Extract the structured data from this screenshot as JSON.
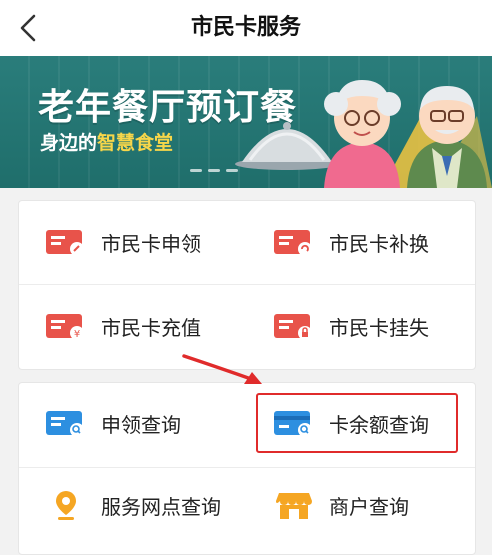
{
  "navbar": {
    "title": "市民卡服务",
    "back_icon": "chevron-left-icon"
  },
  "banner": {
    "title": "老年餐厅预订餐",
    "subtitle_prefix": "身边的",
    "subtitle_highlight": "智慧食堂",
    "colors": {
      "background": "#2a7d7b",
      "highlight": "#f7d64a"
    }
  },
  "card_services": {
    "items": [
      {
        "label": "市民卡申领",
        "icon": "card-apply-icon"
      },
      {
        "label": "市民卡补换",
        "icon": "card-replace-icon"
      },
      {
        "label": "市民卡充值",
        "icon": "card-recharge-icon"
      },
      {
        "label": "市民卡挂失",
        "icon": "card-lock-icon"
      }
    ]
  },
  "query_services": {
    "items": [
      {
        "label": "申领查询",
        "icon": "apply-query-icon"
      },
      {
        "label": "卡余额查询",
        "icon": "balance-query-icon"
      },
      {
        "label": "服务网点查询",
        "icon": "location-pin-icon"
      },
      {
        "label": "商户查询",
        "icon": "shop-icon"
      }
    ]
  },
  "colors": {
    "card_red": "#e8534a",
    "query_blue": "#2d8fe0",
    "pin_orange": "#f5a623",
    "annotation_red": "#e02b2b"
  }
}
